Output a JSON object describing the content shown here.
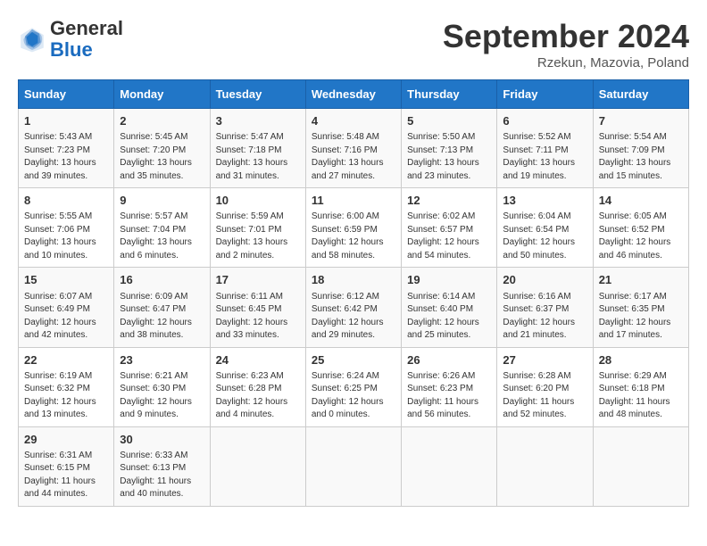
{
  "header": {
    "logo_line1": "General",
    "logo_line2": "Blue",
    "month": "September 2024",
    "location": "Rzekun, Mazovia, Poland"
  },
  "weekdays": [
    "Sunday",
    "Monday",
    "Tuesday",
    "Wednesday",
    "Thursday",
    "Friday",
    "Saturday"
  ],
  "weeks": [
    [
      {
        "day": "1",
        "text": "Sunrise: 5:43 AM\nSunset: 7:23 PM\nDaylight: 13 hours\nand 39 minutes."
      },
      {
        "day": "2",
        "text": "Sunrise: 5:45 AM\nSunset: 7:20 PM\nDaylight: 13 hours\nand 35 minutes."
      },
      {
        "day": "3",
        "text": "Sunrise: 5:47 AM\nSunset: 7:18 PM\nDaylight: 13 hours\nand 31 minutes."
      },
      {
        "day": "4",
        "text": "Sunrise: 5:48 AM\nSunset: 7:16 PM\nDaylight: 13 hours\nand 27 minutes."
      },
      {
        "day": "5",
        "text": "Sunrise: 5:50 AM\nSunset: 7:13 PM\nDaylight: 13 hours\nand 23 minutes."
      },
      {
        "day": "6",
        "text": "Sunrise: 5:52 AM\nSunset: 7:11 PM\nDaylight: 13 hours\nand 19 minutes."
      },
      {
        "day": "7",
        "text": "Sunrise: 5:54 AM\nSunset: 7:09 PM\nDaylight: 13 hours\nand 15 minutes."
      }
    ],
    [
      {
        "day": "8",
        "text": "Sunrise: 5:55 AM\nSunset: 7:06 PM\nDaylight: 13 hours\nand 10 minutes."
      },
      {
        "day": "9",
        "text": "Sunrise: 5:57 AM\nSunset: 7:04 PM\nDaylight: 13 hours\nand 6 minutes."
      },
      {
        "day": "10",
        "text": "Sunrise: 5:59 AM\nSunset: 7:01 PM\nDaylight: 13 hours\nand 2 minutes."
      },
      {
        "day": "11",
        "text": "Sunrise: 6:00 AM\nSunset: 6:59 PM\nDaylight: 12 hours\nand 58 minutes."
      },
      {
        "day": "12",
        "text": "Sunrise: 6:02 AM\nSunset: 6:57 PM\nDaylight: 12 hours\nand 54 minutes."
      },
      {
        "day": "13",
        "text": "Sunrise: 6:04 AM\nSunset: 6:54 PM\nDaylight: 12 hours\nand 50 minutes."
      },
      {
        "day": "14",
        "text": "Sunrise: 6:05 AM\nSunset: 6:52 PM\nDaylight: 12 hours\nand 46 minutes."
      }
    ],
    [
      {
        "day": "15",
        "text": "Sunrise: 6:07 AM\nSunset: 6:49 PM\nDaylight: 12 hours\nand 42 minutes."
      },
      {
        "day": "16",
        "text": "Sunrise: 6:09 AM\nSunset: 6:47 PM\nDaylight: 12 hours\nand 38 minutes."
      },
      {
        "day": "17",
        "text": "Sunrise: 6:11 AM\nSunset: 6:45 PM\nDaylight: 12 hours\nand 33 minutes."
      },
      {
        "day": "18",
        "text": "Sunrise: 6:12 AM\nSunset: 6:42 PM\nDaylight: 12 hours\nand 29 minutes."
      },
      {
        "day": "19",
        "text": "Sunrise: 6:14 AM\nSunset: 6:40 PM\nDaylight: 12 hours\nand 25 minutes."
      },
      {
        "day": "20",
        "text": "Sunrise: 6:16 AM\nSunset: 6:37 PM\nDaylight: 12 hours\nand 21 minutes."
      },
      {
        "day": "21",
        "text": "Sunrise: 6:17 AM\nSunset: 6:35 PM\nDaylight: 12 hours\nand 17 minutes."
      }
    ],
    [
      {
        "day": "22",
        "text": "Sunrise: 6:19 AM\nSunset: 6:32 PM\nDaylight: 12 hours\nand 13 minutes."
      },
      {
        "day": "23",
        "text": "Sunrise: 6:21 AM\nSunset: 6:30 PM\nDaylight: 12 hours\nand 9 minutes."
      },
      {
        "day": "24",
        "text": "Sunrise: 6:23 AM\nSunset: 6:28 PM\nDaylight: 12 hours\nand 4 minutes."
      },
      {
        "day": "25",
        "text": "Sunrise: 6:24 AM\nSunset: 6:25 PM\nDaylight: 12 hours\nand 0 minutes."
      },
      {
        "day": "26",
        "text": "Sunrise: 6:26 AM\nSunset: 6:23 PM\nDaylight: 11 hours\nand 56 minutes."
      },
      {
        "day": "27",
        "text": "Sunrise: 6:28 AM\nSunset: 6:20 PM\nDaylight: 11 hours\nand 52 minutes."
      },
      {
        "day": "28",
        "text": "Sunrise: 6:29 AM\nSunset: 6:18 PM\nDaylight: 11 hours\nand 48 minutes."
      }
    ],
    [
      {
        "day": "29",
        "text": "Sunrise: 6:31 AM\nSunset: 6:15 PM\nDaylight: 11 hours\nand 44 minutes."
      },
      {
        "day": "30",
        "text": "Sunrise: 6:33 AM\nSunset: 6:13 PM\nDaylight: 11 hours\nand 40 minutes."
      },
      {
        "day": "",
        "text": ""
      },
      {
        "day": "",
        "text": ""
      },
      {
        "day": "",
        "text": ""
      },
      {
        "day": "",
        "text": ""
      },
      {
        "day": "",
        "text": ""
      }
    ]
  ]
}
